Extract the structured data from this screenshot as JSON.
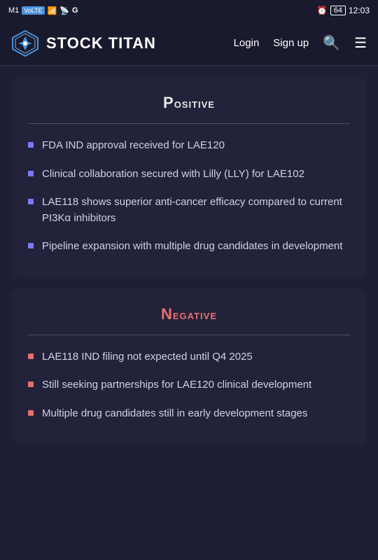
{
  "statusBar": {
    "carrier": "M1",
    "carrierBadge": "VoLTE",
    "signal": "▂▄▆",
    "wifi": "WiFi",
    "network": "G",
    "alarm": "⏰",
    "battery": "64",
    "time": "12:03"
  },
  "navbar": {
    "logoText": "STOCK TITAN",
    "links": [
      {
        "label": "Login"
      },
      {
        "label": "Sign up"
      }
    ]
  },
  "sections": [
    {
      "id": "positive",
      "title": "Positive",
      "titleClass": "positive",
      "markerClass": "",
      "items": [
        "FDA IND approval received for LAE120",
        "Clinical collaboration secured with Lilly (LLY) for LAE102",
        "LAE118 shows superior anti-cancer efficacy compared to current PI3Kα inhibitors",
        "Pipeline expansion with multiple drug candidates in development"
      ]
    },
    {
      "id": "negative",
      "title": "Negative",
      "titleClass": "negative",
      "markerClass": "negative",
      "items": [
        "LAE118 IND filing not expected until Q4 2025",
        "Still seeking partnerships for LAE120 clinical development",
        "Multiple drug candidates still in early development stages"
      ]
    }
  ]
}
